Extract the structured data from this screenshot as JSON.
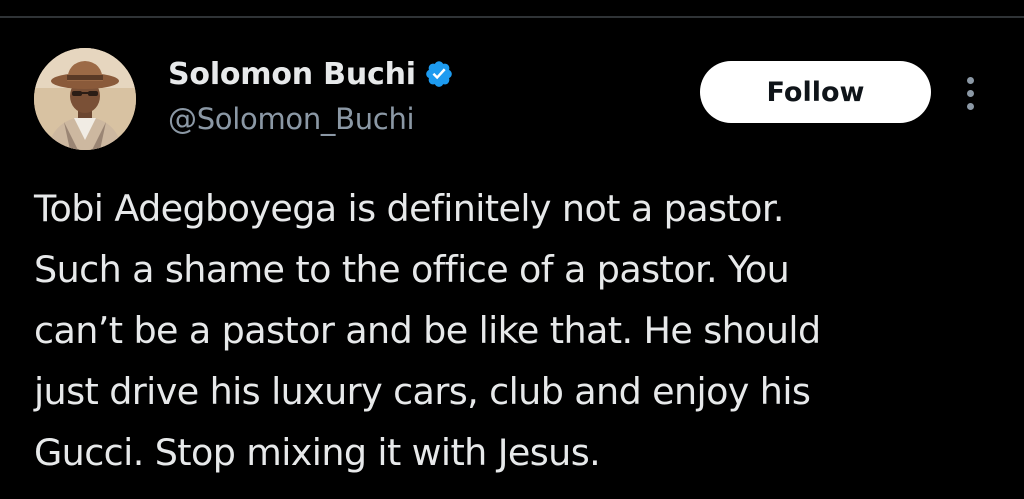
{
  "tweet": {
    "author": {
      "display_name": "Solomon Buchi",
      "handle": "@Solomon_Buchi",
      "verified": true,
      "avatar_icon": "profile-photo-man-in-hat"
    },
    "follow_label": "Follow",
    "more_icon": "more-vertical-icon",
    "text_lines": [
      "Tobi Adegboyega is definitely not a pastor.",
      "Such a shame to the office of a pastor. You",
      "can’t be a pastor and be like that. He should",
      "just drive his luxury cars, club and enjoy his",
      "Gucci. Stop mixing it with Jesus."
    ]
  },
  "colors": {
    "background": "#000000",
    "primary_text": "#e7e9ea",
    "secondary_text": "#8b98a5",
    "verified_badge": "#1d9bf0",
    "follow_button_bg": "#ffffff",
    "follow_button_text": "#0f1419"
  }
}
